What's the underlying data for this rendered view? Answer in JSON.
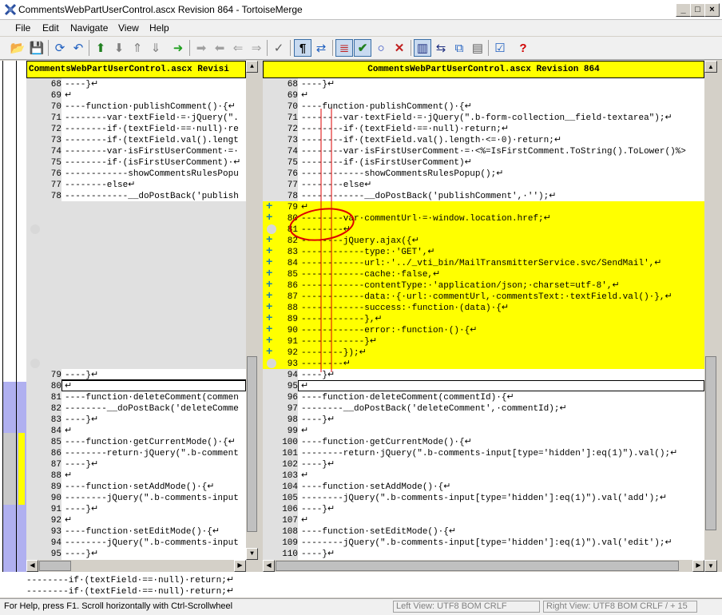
{
  "window": {
    "title": "CommentsWebPartUserControl.ascx Revision 864 - TortoiseMerge",
    "buttons": [
      "_",
      "□",
      "×"
    ]
  },
  "menu": [
    "File",
    "Edit",
    "Navigate",
    "View",
    "Help"
  ],
  "toolbar": {
    "icons": [
      "open-icon",
      "save-icon",
      "reload-icon",
      "undo-icon",
      "prev-conflict-icon",
      "next-conflict-icon",
      "prev-diff-icon",
      "next-diff-icon",
      "next-step-icon",
      "use-theirs-icon",
      "use-mine-icon",
      "use-theirs-before-icon",
      "use-mine-before-icon",
      "mark-resolved-icon",
      "whitespace-icon",
      "wrap-icon",
      "inline-diff-icon",
      "check-icon",
      "circle-icon",
      "close-x-icon",
      "one-pane-icon",
      "two-pane-icon",
      "patch-icon",
      "blame-icon",
      "settings-icon",
      "help-icon"
    ]
  },
  "left": {
    "header": "CommentsWebPartUserControl.ascx Revisi",
    "lines": [
      {
        "n": "68",
        "t": "----}↵"
      },
      {
        "n": "69",
        "t": "↵"
      },
      {
        "n": "70",
        "t": "----function·publishComment()·{↵"
      },
      {
        "n": "71",
        "t": "--------var·textField·=·jQuery(\"."
      },
      {
        "n": "72",
        "t": "--------if·(textField·==·null)·re"
      },
      {
        "n": "73",
        "t": "--------if·(textField.val().lengt"
      },
      {
        "n": "74",
        "t": "--------var·isFirstUserComment·=·"
      },
      {
        "n": "75",
        "t": "--------if·(isFirstUserComment)·↵"
      },
      {
        "n": "76",
        "t": "------------showCommentsRulesPopu"
      },
      {
        "n": "77",
        "t": "--------else↵"
      },
      {
        "n": "78",
        "t": "------------__doPostBack('publish"
      },
      {
        "n": "79",
        "t": "----}↵"
      },
      {
        "n": "80",
        "t": "↵"
      },
      {
        "n": "81",
        "t": "----function·deleteComment(commen"
      },
      {
        "n": "82",
        "t": "--------__doPostBack('deleteComme"
      },
      {
        "n": "83",
        "t": "----}↵"
      },
      {
        "n": "84",
        "t": "↵"
      },
      {
        "n": "85",
        "t": "----function·getCurrentMode()·{↵"
      },
      {
        "n": "86",
        "t": "--------return·jQuery(\".b-comment"
      },
      {
        "n": "87",
        "t": "----}↵"
      },
      {
        "n": "88",
        "t": "↵"
      },
      {
        "n": "89",
        "t": "----function·setAddMode()·{↵"
      },
      {
        "n": "90",
        "t": "--------jQuery(\".b-comments-input"
      },
      {
        "n": "91",
        "t": "----}↵"
      },
      {
        "n": "92",
        "t": "↵"
      },
      {
        "n": "93",
        "t": "----function·setEditMode()·{↵"
      },
      {
        "n": "94",
        "t": "--------jQuery(\".b-comments-input"
      },
      {
        "n": "95",
        "t": "----}↵"
      }
    ]
  },
  "right": {
    "header": "CommentsWebPartUserControl.ascx Revision 864",
    "lines": [
      {
        "n": "68",
        "t": "----}↵"
      },
      {
        "n": "69",
        "t": "↵"
      },
      {
        "n": "70",
        "t": "----function·publishComment()·{↵"
      },
      {
        "n": "71",
        "t": "--------var·textField·=·jQuery(\".b-form-collection__field-textarea\");↵"
      },
      {
        "n": "72",
        "t": "--------if·(textField·==·null)·return;↵"
      },
      {
        "n": "73",
        "t": "--------if·(textField.val().length·<=·0)·return;↵"
      },
      {
        "n": "74",
        "t": "--------var·isFirstUserComment·=·<%=IsFirstComment.ToString().ToLower()%>"
      },
      {
        "n": "75",
        "t": "--------if·(isFirstUserComment)↵"
      },
      {
        "n": "76",
        "t": "------------showCommentsRulesPopup();↵"
      },
      {
        "n": "77",
        "t": "--------else↵"
      },
      {
        "n": "78",
        "t": "------------__doPostBack('publishComment',·'');↵"
      },
      {
        "n": "79",
        "t": "↵"
      },
      {
        "n": "80",
        "t": "--------var·commentUrl·=·window.location.href;↵"
      },
      {
        "n": "81",
        "t": "--------↵"
      },
      {
        "n": "82",
        "t": "--------jQuery.ajax({↵"
      },
      {
        "n": "83",
        "t": "------------type:·'GET',↵"
      },
      {
        "n": "84",
        "t": "------------url:·'../_vti_bin/MailTransmitterService.svc/SendMail',↵"
      },
      {
        "n": "85",
        "t": "------------cache:·false,↵"
      },
      {
        "n": "86",
        "t": "------------contentType:·'application/json;·charset=utf-8',↵"
      },
      {
        "n": "87",
        "t": "------------data:·{·url:·commentUrl,·commentsText:·textField.val()·},↵"
      },
      {
        "n": "88",
        "t": "------------success:·function·(data)·{↵"
      },
      {
        "n": "89",
        "t": "------------},↵"
      },
      {
        "n": "90",
        "t": "------------error:·function·()·{↵"
      },
      {
        "n": "91",
        "t": "------------}↵"
      },
      {
        "n": "92",
        "t": "--------});↵"
      },
      {
        "n": "93",
        "t": "--------↵"
      },
      {
        "n": "94",
        "t": "----}↵"
      },
      {
        "n": "95",
        "t": "↵"
      },
      {
        "n": "96",
        "t": "----function·deleteComment(commentId)·{↵"
      },
      {
        "n": "97",
        "t": "--------__doPostBack('deleteComment',·commentId);↵"
      },
      {
        "n": "98",
        "t": "----}↵"
      },
      {
        "n": "99",
        "t": "↵"
      },
      {
        "n": "100",
        "t": "----function·getCurrentMode()·{↵"
      },
      {
        "n": "101",
        "t": "--------return·jQuery(\".b-comments-input[type='hidden']:eq(1)\").val();↵"
      },
      {
        "n": "102",
        "t": "----}↵"
      },
      {
        "n": "103",
        "t": "↵"
      },
      {
        "n": "104",
        "t": "----function·setAddMode()·{↵"
      },
      {
        "n": "105",
        "t": "--------jQuery(\".b-comments-input[type='hidden']:eq(1)\").val('add');↵"
      },
      {
        "n": "106",
        "t": "----}↵"
      },
      {
        "n": "107",
        "t": "↵"
      },
      {
        "n": "108",
        "t": "----function·setEditMode()·{↵"
      },
      {
        "n": "109",
        "t": "--------jQuery(\".b-comments-input[type='hidden']:eq(1)\").val('edit');↵"
      },
      {
        "n": "110",
        "t": "----}↵"
      }
    ]
  },
  "bottom": {
    "lines": [
      "--------if·(textField·==·null)·return;↵",
      "--------if·(textField·==·null)·return;↵"
    ]
  },
  "status": {
    "help": "For Help, press F1. Scroll horizontally with Ctrl-Scrollwheel",
    "left_view": "Left View: UTF8 BOM CRLF",
    "right_view": "Right View: UTF8 BOM CRLF",
    "right_count": "/ + 15"
  },
  "colors": {
    "added": "#ffff00",
    "empty": "#e0e0e0",
    "locator_blue": "#b0b0f0",
    "annotation_red": "#dd0000"
  }
}
